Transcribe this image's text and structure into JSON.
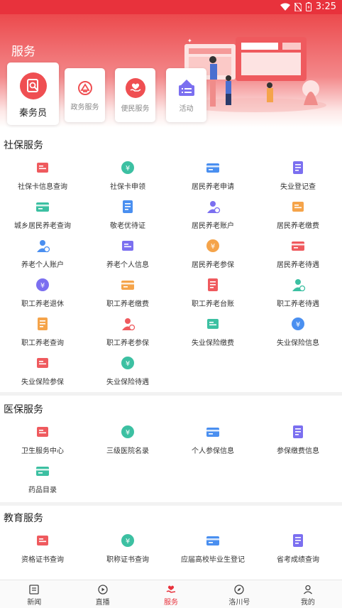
{
  "status_bar": {
    "time": "3:25"
  },
  "header": {
    "title": "服务"
  },
  "quick_cards": [
    {
      "label": "秦务员",
      "icon": "search-doc-icon"
    },
    {
      "label": "政务服务",
      "icon": "gov-emblem-icon"
    },
    {
      "label": "便民服务",
      "icon": "helping-hand-icon"
    },
    {
      "label": "活动",
      "icon": "event-banner-icon"
    }
  ],
  "social_security": {
    "title": "社保服务",
    "items": [
      "社保卡信息查询",
      "社保卡申领",
      "居民养老申请",
      "失业登记查",
      "城乡居民养老查询",
      "敬老优待证",
      "居民养老账户",
      "居民养老缴费",
      "养老个人账户",
      "养老个人信息",
      "居民养老参保",
      "居民养老待遇",
      "职工养老退休",
      "职工养老缴费",
      "职工养老台账",
      "职工养老待遇",
      "职工养老查询",
      "职工养老参保",
      "失业保险缴费",
      "失业保险信息",
      "失业保险参保",
      "失业保险待遇"
    ]
  },
  "medical": {
    "title": "医保服务",
    "items": [
      "卫生服务中心",
      "三级医院名录",
      "个人参保信息",
      "参保缴费信息",
      "药品目录"
    ]
  },
  "education": {
    "title": "教育服务",
    "items": [
      "资格证书查询",
      "职称证书查询",
      "应届高校毕业生登记",
      "省考成绩查询"
    ]
  },
  "bottom_nav": [
    {
      "label": "新闻",
      "icon": "news-icon"
    },
    {
      "label": "直播",
      "icon": "play-icon"
    },
    {
      "label": "服务",
      "icon": "service-icon",
      "active": true
    },
    {
      "label": "洛川号",
      "icon": "compass-icon"
    },
    {
      "label": "我的",
      "icon": "profile-icon"
    }
  ],
  "colors": {
    "brand_red": "#e8323c",
    "icon_red": "#ef5a5e",
    "icon_blue": "#4a8ff0",
    "icon_orange": "#f5a44a",
    "icon_teal": "#3cc0a2",
    "icon_purple": "#7b6ff0"
  }
}
